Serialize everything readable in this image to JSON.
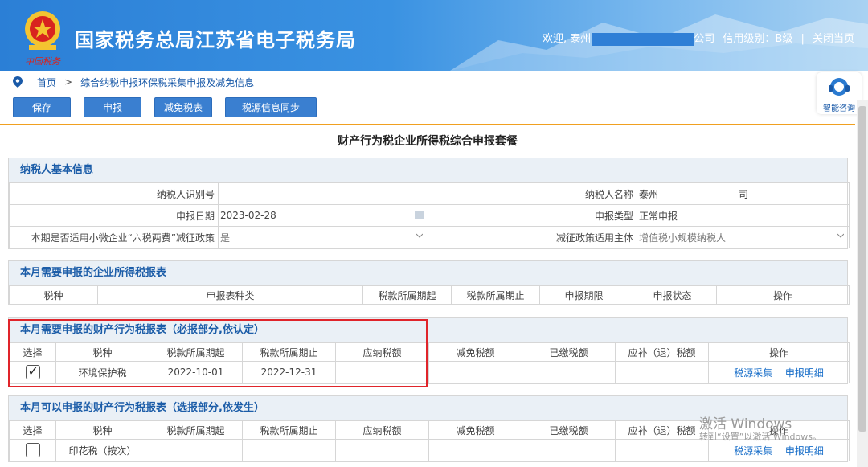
{
  "header": {
    "site_title": "国家税务总局江苏省电子税务局",
    "welcome": "欢迎, 泰州",
    "company_suffix": "公司",
    "credit": "信用级别：B级",
    "close": "关闭当页"
  },
  "breadcrumb": {
    "home": "首页",
    "current": "综合纳税申报环保税采集申报及减免信息"
  },
  "toolbar": {
    "save": "保存",
    "declare": "申报",
    "exempt": "减免税表",
    "sync": "税源信息同步"
  },
  "help": {
    "label": "智能咨询"
  },
  "page_title": "财产行为税企业所得税综合申报套餐",
  "basic": {
    "title": "纳税人基本信息",
    "taxpayer_id_label": "纳税人识别号",
    "taxpayer_id": "",
    "name_label": "纳税人名称",
    "name_prefix": "泰州",
    "name_suffix": "司",
    "date_label": "申报日期",
    "date": "2023-02-28",
    "type_label": "申报类型",
    "type": "正常申报",
    "policy_label": "本期是否适用小微企业“六税两费”减征政策",
    "policy": "是",
    "subject_label": "减征政策适用主体",
    "subject": "增值税小规模纳税人"
  },
  "corp": {
    "title": "本月需要申报的企业所得税报表",
    "headers": [
      "税种",
      "申报表种类",
      "税款所属期起",
      "税款所属期止",
      "申报期限",
      "申报状态",
      "操作"
    ]
  },
  "required": {
    "title": "本月需要申报的财产行为税报表（必报部分,依认定）",
    "headers": [
      "选择",
      "税种",
      "税款所属期起",
      "税款所属期止",
      "应纳税额",
      "减免税额",
      "已缴税额",
      "应补（退）税额",
      "操作"
    ],
    "row": {
      "tax": "环境保护税",
      "start": "2022-10-01",
      "end": "2022-12-31",
      "action1": "税源采集",
      "action2": "申报明细"
    }
  },
  "optional": {
    "title": "本月可以申报的财产行为税报表（选报部分,依发生）",
    "headers": [
      "选择",
      "税种",
      "税款所属期起",
      "税款所属期止",
      "应纳税额",
      "减免税额",
      "已缴税额",
      "应补（退）税额",
      "操作"
    ],
    "row": {
      "tax": "印花税（按次）",
      "action1": "税源采集",
      "action2": "申报明细"
    }
  },
  "watermark": {
    "line1": "激活 Windows",
    "line2": "转到“设置”以激活 Windows。"
  }
}
